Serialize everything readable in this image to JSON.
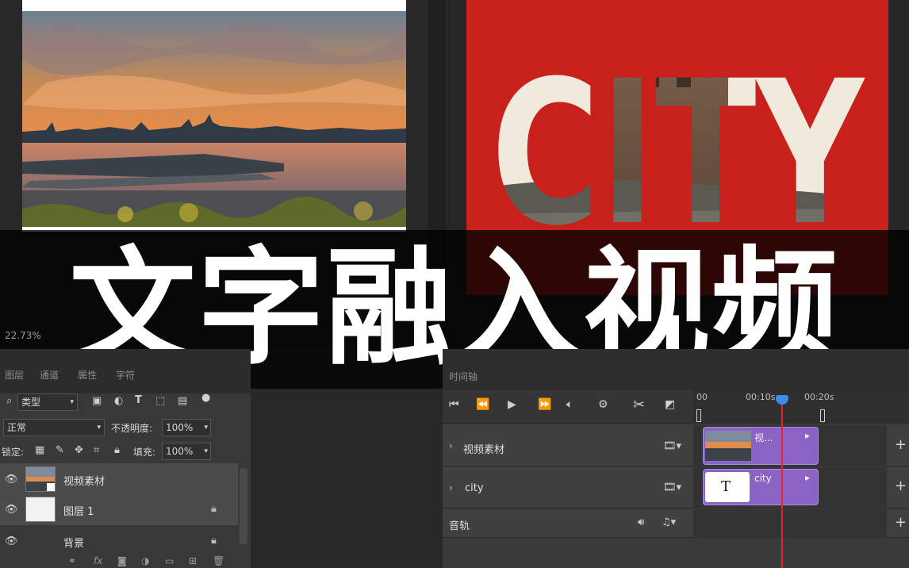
{
  "canvas": {
    "city_text": "CITY",
    "red_color": "#c8201b",
    "zoom": "22.73%"
  },
  "banner": {
    "title": "文字融入视频"
  },
  "layers_panel": {
    "tabs": [
      "图层",
      "通道",
      "属性",
      "字符"
    ],
    "filter_label": "类型",
    "blend_mode": "正常",
    "opacity_label": "不透明度:",
    "opacity_value": "100%",
    "lock_label": "锁定:",
    "fill_label": "填充:",
    "fill_value": "100%",
    "layers": [
      {
        "name": "视频素材",
        "selected": true
      },
      {
        "name": "图层 1",
        "selected": true
      },
      {
        "name": "背景",
        "selected": false
      }
    ]
  },
  "timeline": {
    "tab": "时间轴",
    "ruler": {
      "start": "00",
      "mid": "00:10s",
      "end": "00:20s"
    },
    "tracks": [
      {
        "name": "视频素材",
        "clip_label": "视..."
      },
      {
        "name": "city",
        "clip_label": "city"
      }
    ],
    "audio_track": "音轨",
    "clip_color": "#8b63c4",
    "playhead_color": "#e0262a"
  }
}
